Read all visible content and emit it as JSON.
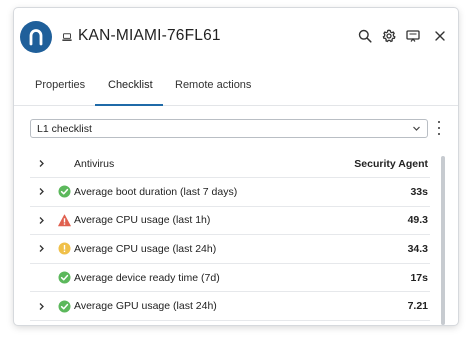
{
  "header": {
    "title": "KAN-MIAMI-76FL61",
    "logo_letter": "n",
    "brand_color": "#1f5f9a"
  },
  "tabs": [
    {
      "label": "Properties",
      "active": false
    },
    {
      "label": "Checklist",
      "active": true
    },
    {
      "label": "Remote actions",
      "active": false
    }
  ],
  "checklist_select": {
    "value": "L1 checklist"
  },
  "table": {
    "header": {
      "name": "Antivirus",
      "value": "Security Agent"
    },
    "rows": [
      {
        "name": "Average boot duration (last 7 days)",
        "value": "33s",
        "status": "ok",
        "expandable": true
      },
      {
        "name": "Average CPU usage (last 1h)",
        "value": "49.3",
        "status": "error",
        "expandable": true
      },
      {
        "name": "Average CPU usage (last 24h)",
        "value": "34.3",
        "status": "warning",
        "expandable": true
      },
      {
        "name": "Average device ready time (7d)",
        "value": "17s",
        "status": "ok",
        "expandable": false
      },
      {
        "name": "Average GPU usage (last 24h)",
        "value": "7.21",
        "status": "ok",
        "expandable": true
      }
    ]
  },
  "colors": {
    "ok": "#5cb85c",
    "error": "#e0604f",
    "warning": "#f0c04a",
    "accent": "#1f6aa8"
  },
  "icons": [
    "search-icon",
    "gear-icon",
    "remote-screen-icon",
    "close-icon",
    "device-icon",
    "chevron-right-icon",
    "chevron-down-icon",
    "more-vertical-icon"
  ]
}
